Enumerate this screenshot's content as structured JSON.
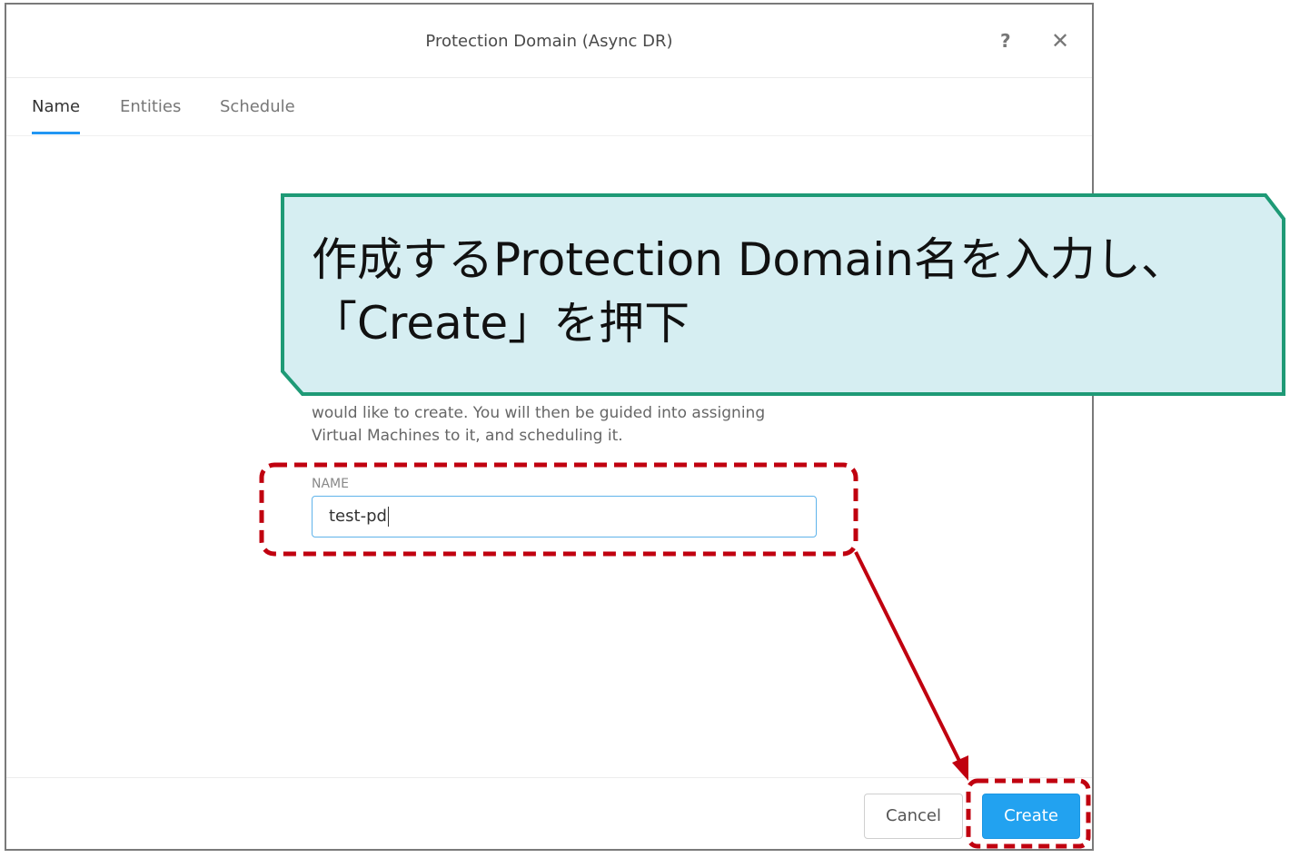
{
  "dialog": {
    "title": "Protection Domain (Async DR)",
    "help_icon": "?",
    "close_icon": "✕"
  },
  "tabs": [
    {
      "label": "Name",
      "active": true
    },
    {
      "label": "Entities",
      "active": false
    },
    {
      "label": "Schedule",
      "active": false
    }
  ],
  "body": {
    "description_line1": "would like to create. You will then be guided into assigning",
    "description_line2": "Virtual Machines to it, and scheduling it.",
    "name_label": "NAME",
    "name_value": "test-pd"
  },
  "footer": {
    "cancel_label": "Cancel",
    "create_label": "Create"
  },
  "callout": {
    "line1": "作成するProtection Domain名を入力し、",
    "line2": "「Create」を押下",
    "fill_color": "#d6eef2",
    "border_color": "#1e9a76"
  },
  "annotation_color": "#c0000f"
}
